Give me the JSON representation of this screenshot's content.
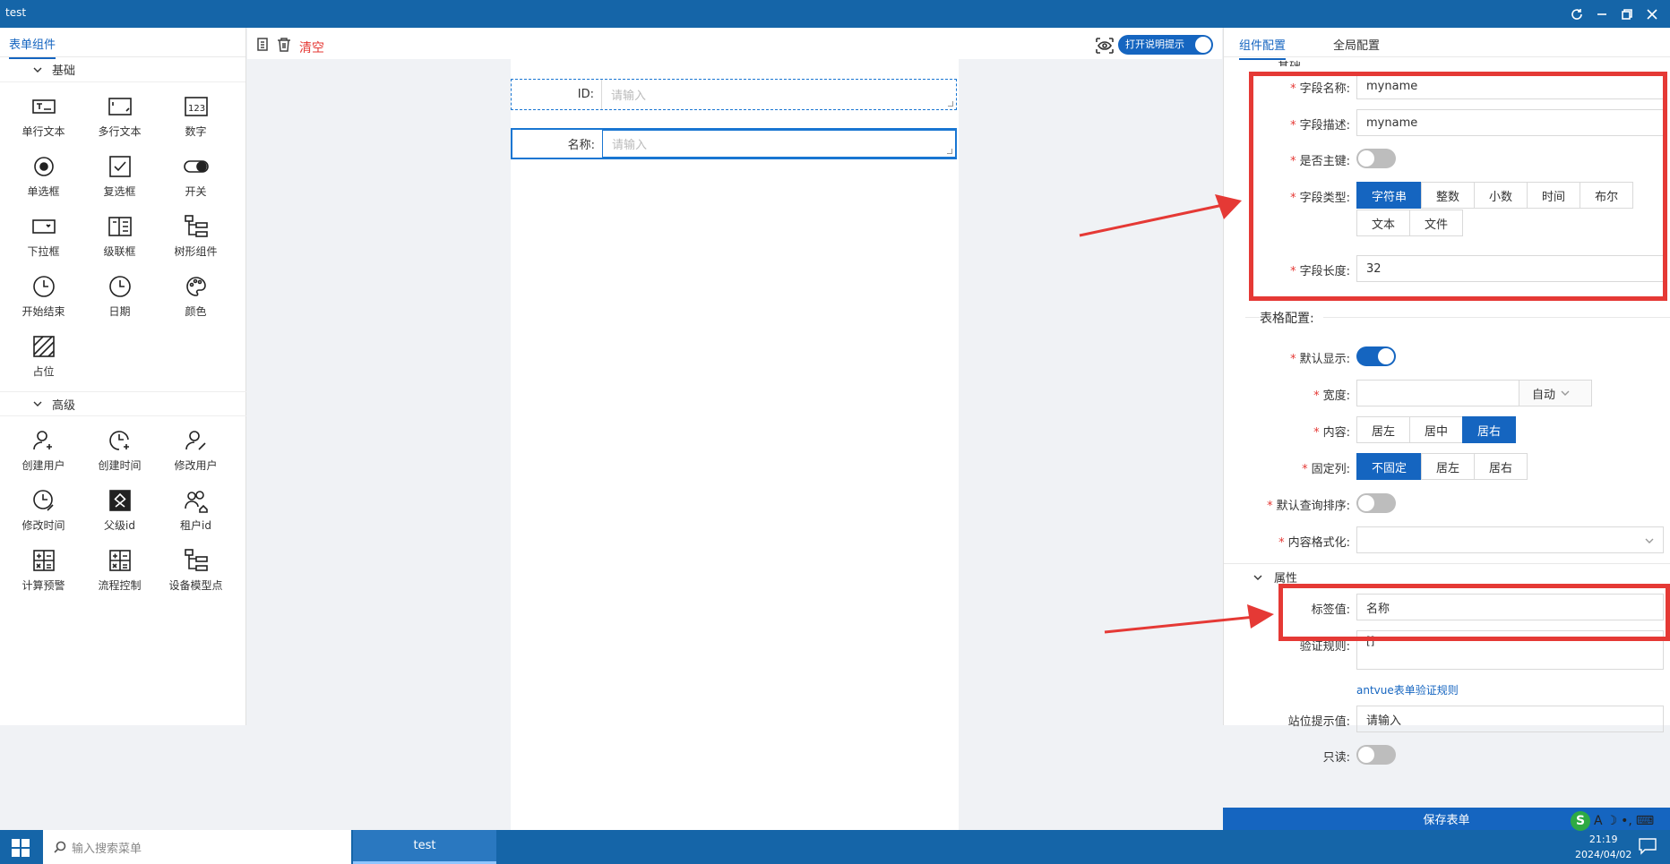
{
  "window": {
    "title": "test"
  },
  "left": {
    "tab": "表单组件",
    "groups": [
      {
        "title": "基础",
        "items": [
          "单行文本",
          "多行文本",
          "数字",
          "单选框",
          "复选框",
          "开关",
          "下拉框",
          "级联框",
          "树形组件",
          "开始结束",
          "日期",
          "颜色",
          "占位"
        ]
      },
      {
        "title": "高级",
        "items": [
          "创建用户",
          "创建时间",
          "修改用户",
          "修改时间",
          "父级id",
          "租户id",
          "计算预警",
          "流程控制",
          "设备模型点"
        ]
      }
    ]
  },
  "toolbar": {
    "clear": "清空",
    "hint_toggle": "打开说明提示"
  },
  "canvas": {
    "fields": [
      {
        "label": "ID:",
        "placeholder": "请输入"
      },
      {
        "label": "名称:",
        "placeholder": "请输入"
      }
    ]
  },
  "right": {
    "tabs": [
      "组件配置",
      "全局配置"
    ],
    "section_basic": "基础",
    "field_name": {
      "label": "字段名称:",
      "value": "myname"
    },
    "field_desc": {
      "label": "字段描述:",
      "value": "myname"
    },
    "is_primary": {
      "label": "是否主键:",
      "on": false
    },
    "field_type": {
      "label": "字段类型:",
      "options": [
        "字符串",
        "整数",
        "小数",
        "时间",
        "布尔",
        "文本",
        "文件"
      ],
      "selected": "字符串"
    },
    "field_length": {
      "label": "字段长度:",
      "value": "32"
    },
    "table_config_title": "表格配置:",
    "default_show": {
      "label": "默认显示:",
      "on": true
    },
    "width": {
      "label": "宽度:",
      "unit": "自动"
    },
    "content": {
      "label": "内容:",
      "options": [
        "居左",
        "居中",
        "居右"
      ],
      "selected": "居右"
    },
    "fixed_col": {
      "label": "固定列:",
      "options": [
        "不固定",
        "居左",
        "居右"
      ],
      "selected": "不固定"
    },
    "default_sort": {
      "label": "默认查询排序:",
      "on": false
    },
    "content_format": {
      "label": "内容格式化:"
    },
    "attr_title": "属性",
    "tag_value": {
      "label": "标签值:",
      "value": "名称"
    },
    "validate": {
      "label": "验证规则:",
      "value": "[]"
    },
    "validate_link": "antvue表单验证规则",
    "placeholder_val": {
      "label": "站位提示值:",
      "value": "请输入"
    },
    "readonly": {
      "label": "只读:",
      "on": false
    },
    "save": "保存表单"
  },
  "taskbar": {
    "search_placeholder": "输入搜索菜单",
    "task": "test",
    "time": "21:19",
    "date": "2024/04/02",
    "ime": "A"
  },
  "colors": {
    "primary": "#1565c0",
    "titlebar": "#1565a8",
    "annotation": "#e53935"
  }
}
